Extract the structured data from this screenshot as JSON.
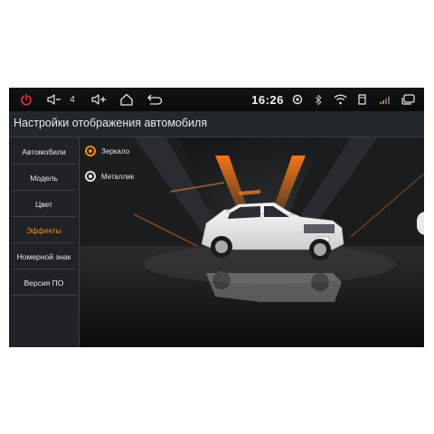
{
  "statusbar": {
    "volume_level": "4",
    "time": "16:26",
    "icons": [
      "power-icon",
      "volume-down-icon",
      "volume-up-icon",
      "home-icon",
      "back-icon",
      "location-icon",
      "bluetooth-icon",
      "wifi-icon",
      "sd-card-icon",
      "signal-icon",
      "recent-apps-icon"
    ],
    "accent_power": "#e03030"
  },
  "title": "Настройки отображения автомобиля",
  "sidebar": {
    "items": [
      {
        "label": "Автомобили",
        "active": false
      },
      {
        "label": "Модель",
        "active": false
      },
      {
        "label": "Цвет",
        "active": false
      },
      {
        "label": "Эффекты",
        "active": true
      },
      {
        "label": "Номерной знак",
        "active": false
      },
      {
        "label": "Версия ПО",
        "active": false
      }
    ]
  },
  "effects": {
    "options": [
      {
        "label": "Зеркало",
        "selected": true
      },
      {
        "label": "Металлик",
        "selected": false
      }
    ]
  },
  "colors": {
    "accent": "#ff8a1c",
    "background": "#1a1c1f"
  }
}
